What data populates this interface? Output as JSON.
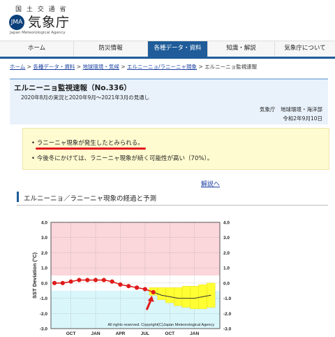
{
  "header": {
    "ministry": "国 土 交 通 省",
    "agency_name": "気象庁",
    "agency_en": "Japan Meteorological Agency",
    "logo_mark": "JMA"
  },
  "nav": {
    "items": [
      {
        "label": "ホーム"
      },
      {
        "label": "防災情報"
      },
      {
        "label": "各種データ・資料"
      },
      {
        "label": "知識・解説"
      },
      {
        "label": "気象庁について"
      }
    ]
  },
  "breadcrumb": {
    "items": [
      "ホーム",
      "各種データ・資料",
      "地球環境・気候",
      "エルニーニョ/ラニーニャ現象",
      "エルニーニョ監視速報"
    ],
    "separator": ">"
  },
  "report": {
    "title": "エルニーニョ監視速報（No.336）",
    "period": "2020年8月の実況と2020年9月～2021年3月の見通し",
    "department": "気象庁　地球環境・海洋部",
    "date": "令和2年9月10日"
  },
  "summary": {
    "bullet_1": "ラニーニャ現象が発生したとみられる。",
    "bullet_2": "今後冬にかけては、ラニーニャ現象が続く可能性が高い（70%）。"
  },
  "explain_link": "解説へ",
  "section_title": "エルニーニョ／ラニーニャ現象の経過と予測",
  "chart_data": {
    "type": "line",
    "ylabel": "SST Deviation (°C)",
    "ylim": [
      -3.0,
      4.0
    ],
    "y_ticks": [
      "4.0",
      "3.0",
      "2.0",
      "1.0",
      "0.0",
      "-1.0",
      "-2.0",
      "-3.0"
    ],
    "x_ticks": [
      "OCT",
      "JAN",
      "APR",
      "JUL",
      "OCT",
      "JAN"
    ],
    "copyright": "All rights reserved. Copyright(C)Japan Meteorological Agency",
    "colors": {
      "el_nino_band": "#fbd6da",
      "neutral_band": "#ffffff",
      "la_nina_band": "#d9f6fb",
      "observed": "#e01a1a",
      "forecast_range": "#ffff33",
      "forecast_line": "#333333",
      "arrow": "#e01a1a"
    },
    "observed": {
      "months": [
        "2019-08",
        "2019-09",
        "2019-10",
        "2019-11",
        "2019-12",
        "2020-01",
        "2020-02",
        "2020-03",
        "2020-04",
        "2020-05",
        "2020-06",
        "2020-07",
        "2020-08"
      ],
      "values": [
        0.0,
        0.0,
        0.1,
        0.2,
        0.2,
        0.2,
        0.2,
        0.1,
        -0.1,
        -0.2,
        -0.3,
        -0.4,
        -0.6
      ]
    },
    "forecast": {
      "months": [
        "2020-08",
        "2020-09",
        "2020-10",
        "2020-11",
        "2020-12",
        "2021-01",
        "2021-02",
        "2021-03"
      ],
      "center": [
        -0.6,
        -0.8,
        -0.9,
        -1.0,
        -1.0,
        -1.0,
        -0.9,
        -0.8
      ],
      "upper": [
        -0.3,
        -0.3,
        -0.3,
        -0.3,
        -0.2,
        -0.2,
        -0.1,
        0.0
      ],
      "lower": [
        -0.8,
        -1.1,
        -1.3,
        -1.5,
        -1.6,
        -1.7,
        -1.7,
        -1.6
      ]
    }
  }
}
